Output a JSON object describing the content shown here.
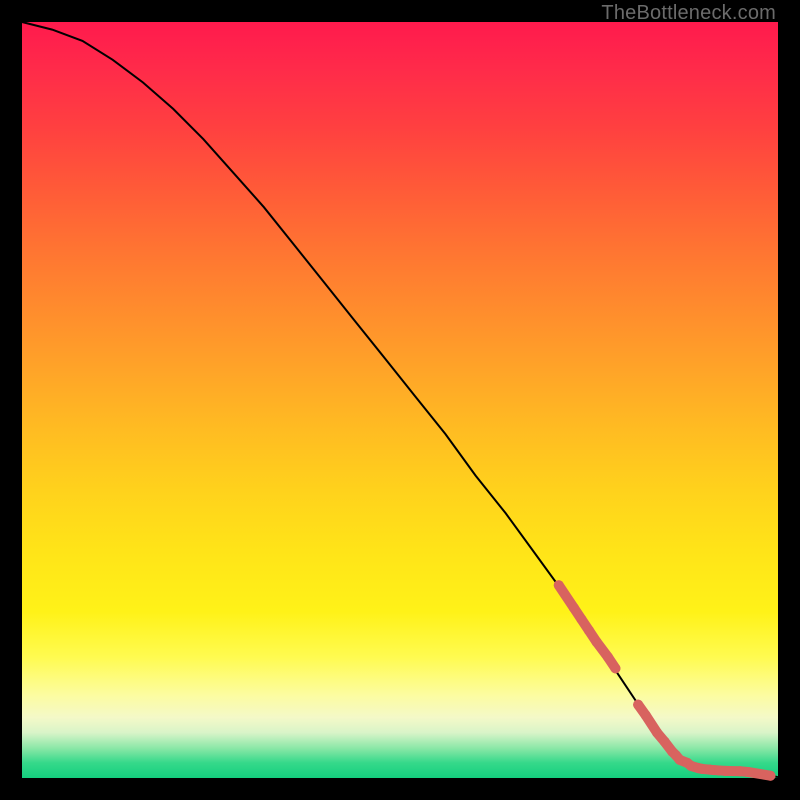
{
  "watermark": "TheBottleneck.com",
  "chart_data": {
    "type": "line",
    "title": "",
    "xlabel": "",
    "ylabel": "",
    "xlim": [
      0,
      100
    ],
    "ylim": [
      0,
      100
    ],
    "grid": false,
    "legend": false,
    "series": [
      {
        "name": "curve",
        "x": [
          0,
          4,
          8,
          12,
          16,
          20,
          24,
          28,
          32,
          36,
          40,
          44,
          48,
          52,
          56,
          60,
          64,
          68,
          72,
          76,
          80,
          82,
          84,
          86,
          88,
          90,
          92,
          94,
          96,
          98,
          100
        ],
        "y": [
          100,
          99,
          97.5,
          95,
          92,
          88.5,
          84.5,
          80,
          75.5,
          70.5,
          65.5,
          60.5,
          55.5,
          50.5,
          45.5,
          40,
          35,
          29.5,
          24,
          18,
          12,
          9,
          6,
          3.5,
          2,
          1.2,
          1.0,
          0.9,
          0.8,
          0.6,
          0.1
        ]
      }
    ],
    "highlighted_points": {
      "name": "measured-points",
      "color": "#d8635f",
      "x": [
        71,
        73,
        74,
        75,
        76,
        77.5,
        78.5,
        81.5,
        82.5,
        84,
        85,
        86,
        86.5,
        87,
        88,
        88.5,
        89.5,
        90,
        91,
        91.5,
        92.2,
        93,
        95,
        96,
        99
      ],
      "y": [
        25.5,
        22.5,
        21,
        19.5,
        18,
        16,
        14.5,
        9.7,
        8.3,
        6,
        4.8,
        3.5,
        3.0,
        2.4,
        2,
        1.6,
        1.3,
        1.2,
        1.1,
        1.05,
        1.0,
        0.95,
        0.9,
        0.8,
        0.3
      ]
    }
  }
}
